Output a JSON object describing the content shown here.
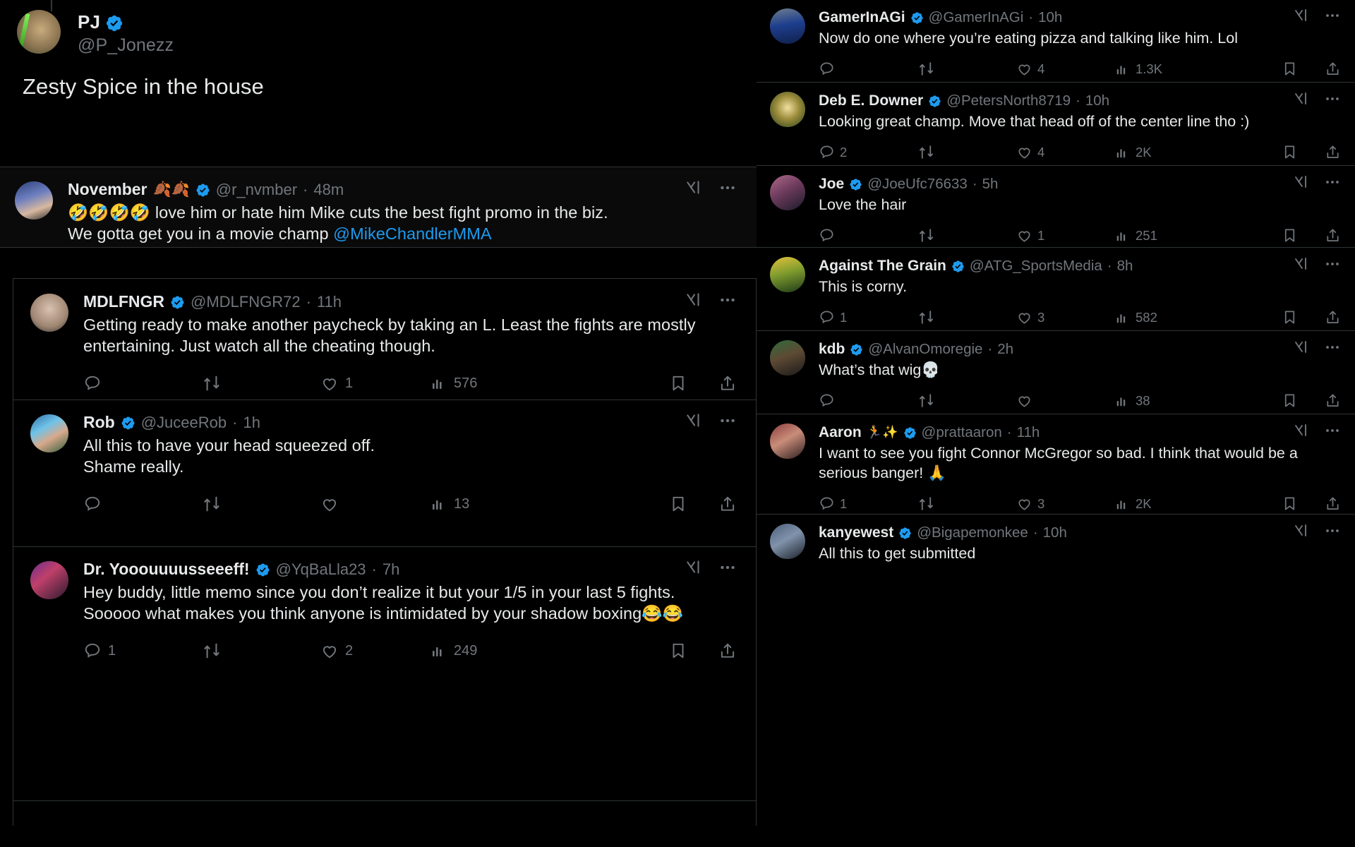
{
  "app": {
    "name": "X",
    "theme": "dark",
    "accent": "#1d9bf0",
    "muted": "#71767b"
  },
  "icons": {
    "verified": "verified-badge-icon",
    "reply": "reply-icon",
    "retweet": "retweet-icon",
    "like": "like-heart-icon",
    "views": "views-bar-icon",
    "bookmark": "bookmark-icon",
    "share": "share-icon",
    "grok": "grok-icon",
    "more": "more-options-icon"
  },
  "root_post": {
    "display_name": "PJ",
    "handle": "@P_Jonezz",
    "verified": true,
    "text": "Zesty Spice in the house"
  },
  "left_column": {
    "replies": [
      {
        "display_name": "November",
        "name_emoji": "🍂🍂",
        "handle": "@r_nvmber",
        "timestamp": "48m",
        "verified": true,
        "selected": true,
        "text_lead": "🤣🤣🤣🤣 love him or hate him Mike cuts the best fight promo in the biz.",
        "text_line2_pre": "We gotta get you in a movie champ ",
        "mention": "@MikeChandlerMMA",
        "actions": {
          "reply": "",
          "retweet": "",
          "like": "",
          "views": ""
        },
        "show_actions": false
      },
      {
        "display_name": "MDLFNGR",
        "name_emoji": "",
        "handle": "@MDLFNGR72",
        "timestamp": "11h",
        "verified": true,
        "selected": false,
        "text_lead": "Getting ready to make another paycheck by taking an L. Least the fights are mostly entertaining. Just watch all the cheating though.",
        "text_line2_pre": "",
        "mention": "",
        "actions": {
          "reply": "",
          "retweet": "",
          "like": "1",
          "views": "576"
        },
        "show_actions": true
      },
      {
        "display_name": "Rob",
        "name_emoji": "",
        "handle": "@JuceeRob",
        "timestamp": "1h",
        "verified": true,
        "selected": false,
        "text_lead": "All this to have your head squeezed off.",
        "text_line2_pre": "Shame really.",
        "mention": "",
        "actions": {
          "reply": "",
          "retweet": "",
          "like": "",
          "views": "13"
        },
        "show_actions": true
      },
      {
        "display_name": "Dr. Yooouuuusseeeff!",
        "name_emoji": "",
        "handle": "@YqBaLla23",
        "timestamp": "7h",
        "verified": true,
        "selected": false,
        "text_lead": "Hey buddy, little memo since you don’t realize it but your 1/5 in your last 5 fights. Sooooo what makes you think anyone is intimidated by your shadow boxing😂😂",
        "text_line2_pre": "",
        "mention": "",
        "actions": {
          "reply": "1",
          "retweet": "",
          "like": "2",
          "views": "249"
        },
        "show_actions": true
      }
    ]
  },
  "right_column": {
    "replies": [
      {
        "display_name": "GamerInAGi",
        "name_emoji": "",
        "handle": "@GamerInAGi",
        "timestamp": "10h",
        "verified": true,
        "text": "Now do one where you’re eating pizza and talking like him. Lol",
        "actions": {
          "reply": "",
          "retweet": "",
          "like": "4",
          "views": "1.3K"
        }
      },
      {
        "display_name": "Deb E. Downer",
        "name_emoji": "",
        "handle": "@PetersNorth8719",
        "timestamp": "10h",
        "verified": true,
        "text": "Looking great champ. Move that head off of the center line tho :)",
        "actions": {
          "reply": "2",
          "retweet": "",
          "like": "4",
          "views": "2K"
        }
      },
      {
        "display_name": "Joe",
        "name_emoji": "",
        "handle": "@JoeUfc76633",
        "timestamp": "5h",
        "verified": true,
        "text": "Love the hair",
        "actions": {
          "reply": "",
          "retweet": "",
          "like": "1",
          "views": "251"
        }
      },
      {
        "display_name": "Against The Grain",
        "name_emoji": "",
        "handle": "@ATG_SportsMedia",
        "timestamp": "8h",
        "verified": true,
        "text": "This is corny.",
        "actions": {
          "reply": "1",
          "retweet": "",
          "like": "3",
          "views": "582"
        }
      },
      {
        "display_name": "kdb",
        "name_emoji": "",
        "handle": "@AlvanOmoregie",
        "timestamp": "2h",
        "verified": true,
        "text": "What’s that wig💀",
        "actions": {
          "reply": "",
          "retweet": "",
          "like": "",
          "views": "38"
        }
      },
      {
        "display_name": "Aaron",
        "name_emoji": "🏃✨",
        "handle": "@prattaaron",
        "timestamp": "11h",
        "verified": true,
        "text": "I want to see you fight Connor McGregor so bad. I think that would be a serious banger! 🙏",
        "actions": {
          "reply": "1",
          "retweet": "",
          "like": "3",
          "views": "2K"
        }
      },
      {
        "display_name": "kanyewest",
        "name_emoji": "",
        "handle": "@Bigapemonkee",
        "timestamp": "10h",
        "verified": true,
        "text": "All this to get submitted",
        "actions": {
          "reply": "",
          "retweet": "",
          "like": "",
          "views": ""
        }
      }
    ]
  }
}
